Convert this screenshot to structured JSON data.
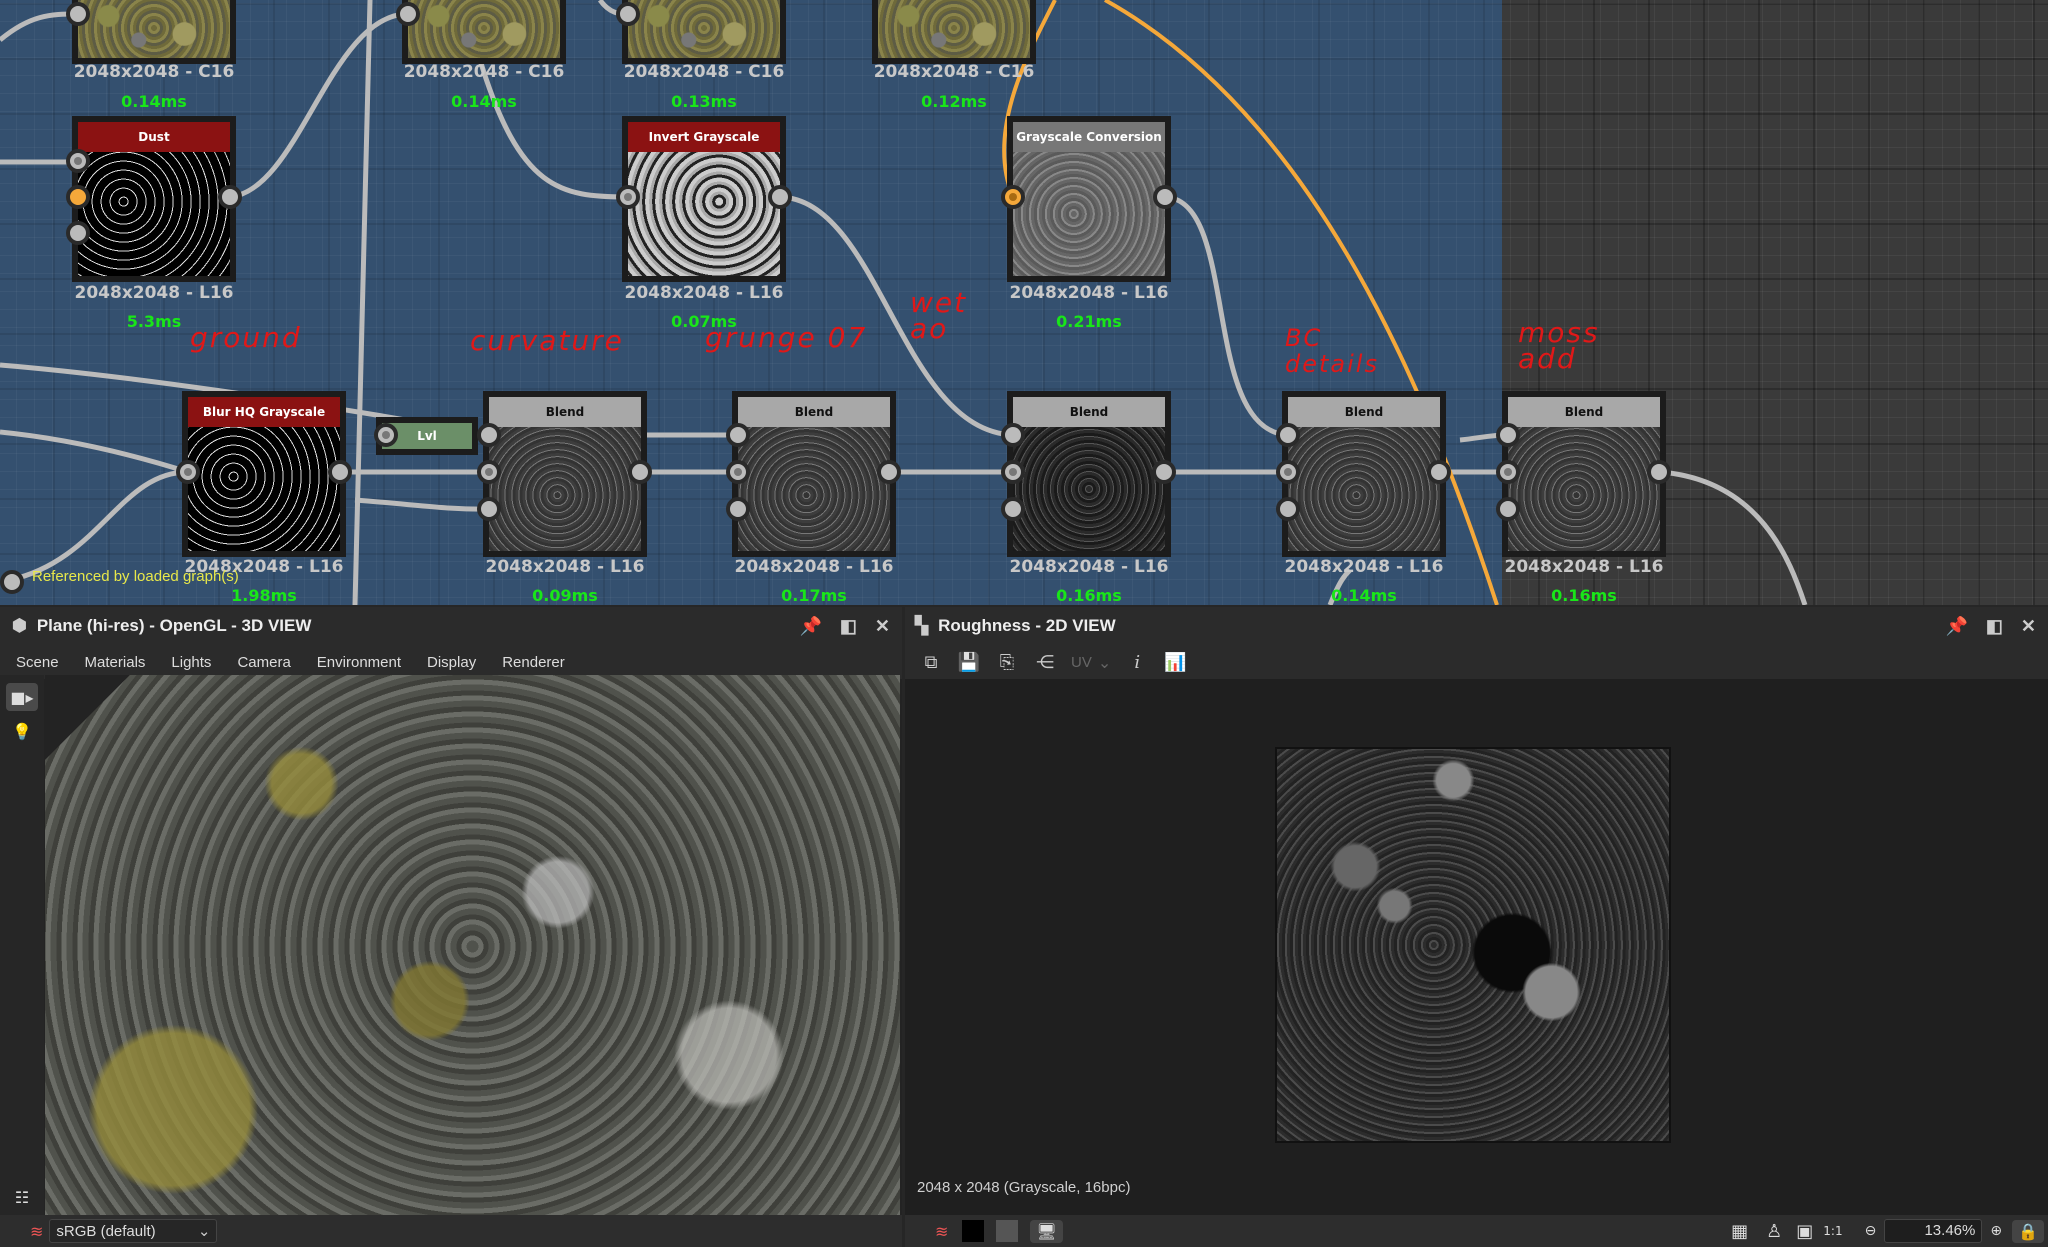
{
  "graph": {
    "top_nodes": [
      {
        "id": "bitmap-1",
        "res": "2048x2048 - C16",
        "time": "0.14ms"
      },
      {
        "id": "bitmap-2",
        "res": "2048x2048 - C16",
        "time": "0.14ms"
      },
      {
        "id": "bitmap-3",
        "res": "2048x2048 - C16",
        "time": "0.13ms"
      },
      {
        "id": "bitmap-4",
        "res": "2048x2048 - C16",
        "time": "0.12ms"
      }
    ],
    "mid_nodes": [
      {
        "title": "Dust",
        "res": "2048x2048 - L16",
        "time": "5.3ms"
      },
      {
        "title": "Invert Grayscale",
        "res": "2048x2048 - L16",
        "time": "0.07ms"
      },
      {
        "title": "Grayscale Conversion",
        "res": "2048x2048 - L16",
        "time": "0.21ms"
      }
    ],
    "bottom_nodes": [
      {
        "title": "Blur HQ Grayscale",
        "res": "2048x2048 - L16",
        "time": "1.98ms",
        "note": "ground"
      },
      {
        "title": "Blend",
        "res": "2048x2048 - L16",
        "time": "0.09ms",
        "note": "curvature"
      },
      {
        "title": "Blend",
        "res": "2048x2048 - L16",
        "time": "0.17ms",
        "note": "grunge 07"
      },
      {
        "title": "Blend",
        "res": "2048x2048 - L16",
        "time": "0.16ms",
        "note": "wet ao"
      },
      {
        "title": "Blend",
        "res": "2048x2048 - L16",
        "time": "0.14ms",
        "note": "BC details"
      },
      {
        "title": "Blend",
        "res": "2048x2048 - L16",
        "time": "0.16ms",
        "note": "moss add"
      }
    ],
    "levels_node": {
      "title": "Lvl"
    },
    "referenced_note": "Referenced by loaded graph(s)",
    "colors": {
      "frame": "#34506f",
      "wire": "#bbbbbb",
      "wire_active": "#f5a83a",
      "annotation": "#e01818",
      "timing": "#19e619"
    }
  },
  "view3d": {
    "title": "Plane (hi-res) - OpenGL - 3D VIEW",
    "menu": [
      "Scene",
      "Materials",
      "Lights",
      "Camera",
      "Environment",
      "Display",
      "Renderer"
    ],
    "colorspace": "sRGB (default)"
  },
  "view2d": {
    "title": "Roughness - 2D VIEW",
    "uv_label": "UV",
    "status": "2048 x 2048 (Grayscale, 16bpc)",
    "zoom": "13.46%"
  }
}
